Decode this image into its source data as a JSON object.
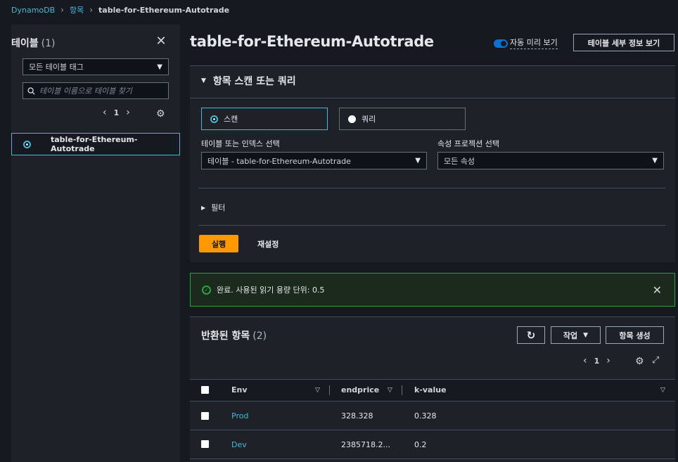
{
  "breadcrumb": {
    "root": "DynamoDB",
    "items": "항목",
    "current": "table-for-Ethereum-Autotrade"
  },
  "sidebar": {
    "title": "테이블",
    "count": "(1)",
    "tag_filter": "모든 테이블 태그",
    "search_placeholder": "테이블 이름으로 테이블 찾기",
    "page": "1",
    "tables": [
      "table-for-Ethereum-Autotrade"
    ]
  },
  "header": {
    "title": "table-for-Ethereum-Autotrade",
    "auto_preview_label": "자동 미리 보기",
    "details_button": "테이블 세부 정보 보기"
  },
  "scan": {
    "section_title": "항목 스캔 또는 쿼리",
    "scan_label": "스캔",
    "query_label": "쿼리",
    "table_index_label": "테이블 또는 인덱스 선택",
    "table_index_value": "테이블 - table-for-Ethereum-Autotrade",
    "projection_label": "속성 프로젝션 선택",
    "projection_value": "모든 속성",
    "filter_label": "필터",
    "run_button": "실행",
    "reset_button": "재설정"
  },
  "flash": {
    "message": "완료. 사용된 읽기 용량 단위: 0.5"
  },
  "results": {
    "title": "반환된 항목",
    "count": "(2)",
    "action_button": "작업",
    "create_button": "항목 생성",
    "page": "1",
    "columns": [
      "Env",
      "endprice",
      "k-value"
    ],
    "rows": [
      {
        "env": "Prod",
        "endprice": "328.328",
        "kvalue": "0.328"
      },
      {
        "env": "Dev",
        "endprice": "2385718.2...",
        "kvalue": "0.2"
      }
    ]
  },
  "colors": {
    "accent": "#44b9d6",
    "primary_button": "#ff9900",
    "success": "#2ea043",
    "toggle": "#0972d3"
  }
}
